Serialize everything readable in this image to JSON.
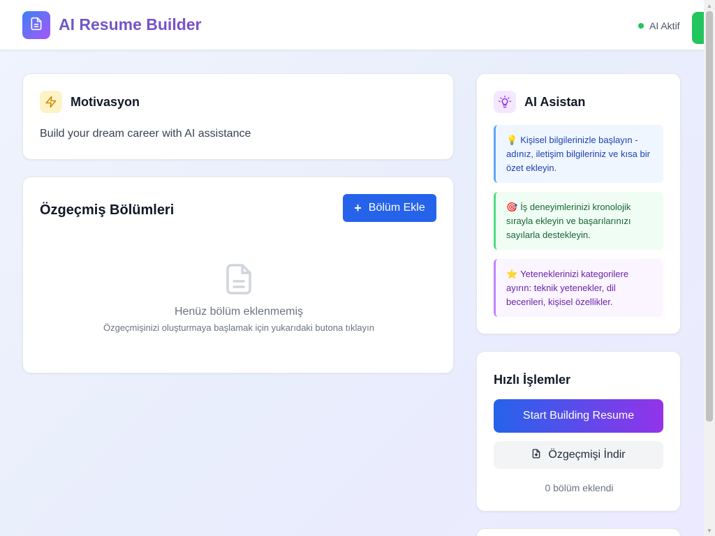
{
  "header": {
    "app_title": "AI Resume Builder",
    "status_text": "AI Aktif",
    "status_color": "#22c55e",
    "logo_icon": "document-icon"
  },
  "motivation": {
    "title": "Motivasyon",
    "icon": "lightning-icon",
    "text": "Build your dream career with AI assistance"
  },
  "sections": {
    "title": "Özgeçmiş Bölümleri",
    "add_button_label": "Bölüm Ekle",
    "empty_icon": "document-icon",
    "empty_title": "Henüz bölüm eklenmemiş",
    "empty_subtitle": "Özgeçmişinizi oluşturmaya başlamak için yukarıdaki butona tıklayın"
  },
  "assistant": {
    "title": "AI Asistan",
    "icon": "lightbulb-icon",
    "tips": [
      {
        "emoji": "💡",
        "text": "Kişisel bilgilerinizle başlayın - adınız, iletişim bilgileriniz ve kısa bir özet ekleyin."
      },
      {
        "emoji": "🎯",
        "text": "İş deneyimlerinizi kronolojik sırayla ekleyin ve başarılarınızı sayılarla destekleyin."
      },
      {
        "emoji": "⭐",
        "text": "Yeteneklerinizi kategorilere ayırın: teknik yetenekler, dil becerileri, kişisel özellikler."
      }
    ]
  },
  "quick_actions": {
    "title": "Hızlı İşlemler",
    "start_label": "Start Building Resume",
    "download_label": "Özgeçmişi İndir",
    "count_text": "0 bölüm eklendi"
  }
}
